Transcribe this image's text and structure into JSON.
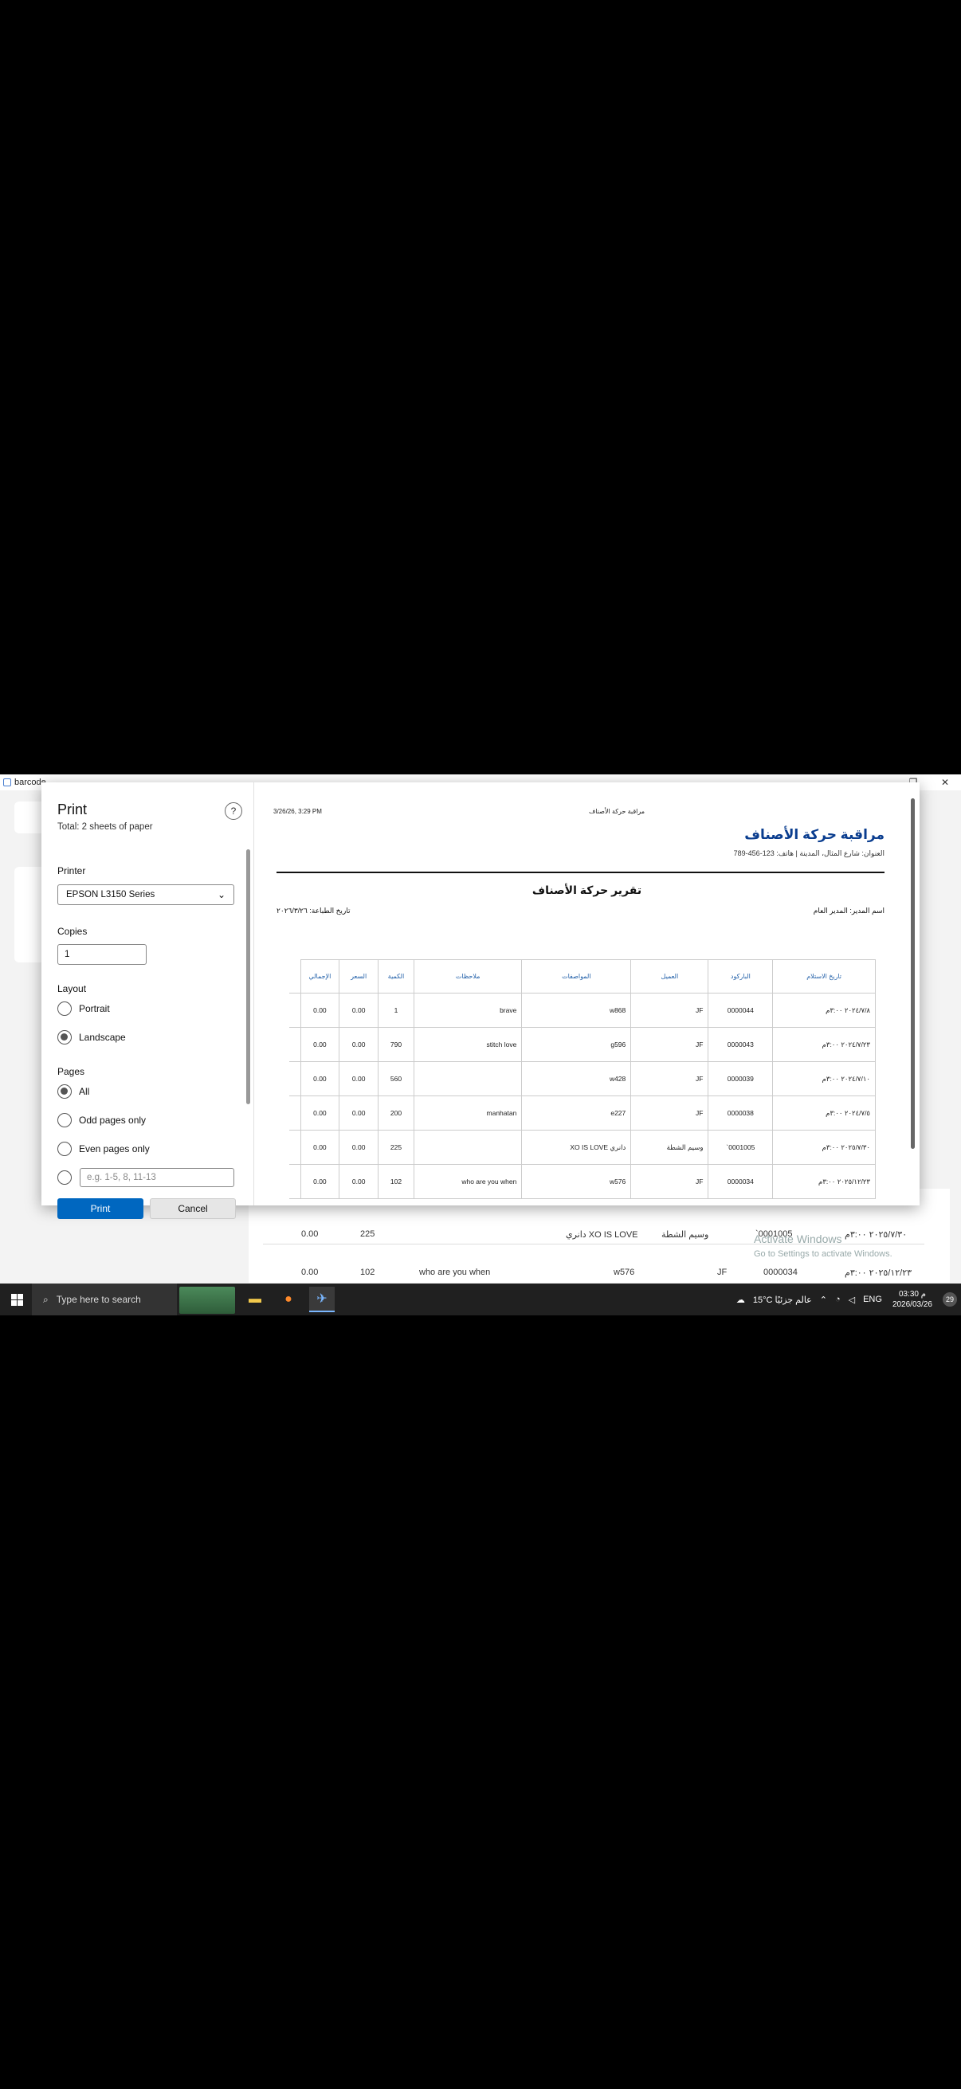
{
  "app": {
    "title": "barcode"
  },
  "window_controls": {
    "minimize": "—",
    "restore": "❐",
    "close": "✕"
  },
  "background": {
    "rows": [
      {
        "total": "0.00",
        "qty": "225",
        "notes": "",
        "desc": "XO IS LOVE دانري",
        "client": "وسيم الشطة",
        "barcode": "`0001005",
        "date": "٢٠٢٥/٧/٣٠ ٣:٠٠م"
      },
      {
        "total": "0.00",
        "qty": "102",
        "notes": "who are you when",
        "desc": "w576",
        "client": "JF",
        "barcode": "0000034",
        "date": "٢٠٢٥/١٢/٢٣ ٣:٠٠م"
      }
    ],
    "watermark_title": "Activate Windows",
    "watermark_sub": "Go to Settings to activate Windows."
  },
  "print": {
    "title": "Print",
    "subtitle": "Total: 2 sheets of paper",
    "help": "?",
    "printer_label": "Printer",
    "printer_value": "EPSON L3150 Series",
    "copies_label": "Copies",
    "copies_value": "1",
    "layout_label": "Layout",
    "portrait": "Portrait",
    "landscape": "Landscape",
    "pages_label": "Pages",
    "all": "All",
    "odd": "Odd pages only",
    "even": "Even pages only",
    "range_placeholder": "e.g. 1-5, 8, 11-13",
    "print_btn": "Print",
    "cancel_btn": "Cancel"
  },
  "preview": {
    "date": "3/26/26, 3:29 PM",
    "header_center": "مراقبة حركة الأصناف",
    "company_title": "مراقبة حركة الأصناف",
    "address": "العنوان: شارع المثال، المدينة | هاتف: 123-456-789",
    "report_title": "تقرير حركة الأصناف",
    "manager": "اسم المدير: المدير العام",
    "print_date": "تاريخ الطباعة: ٢٠٢٦/٣/٢٦",
    "headers": [
      "الإجمالي",
      "السعر",
      "الكمية",
      "ملاحظات",
      "المواصفات",
      "العميل",
      "الباركود",
      "تاريخ الاستلام"
    ],
    "rows": [
      [
        "0.00",
        "0.00",
        "1",
        "brave",
        "w868",
        "JF",
        "0000044",
        "٢٠٢٤/٧/٨ ٣:٠٠م"
      ],
      [
        "0.00",
        "0.00",
        "790",
        "stitch love",
        "g596",
        "JF",
        "0000043",
        "٢٠٢٤/٧/٢٣ ٣:٠٠م"
      ],
      [
        "0.00",
        "0.00",
        "560",
        "",
        "w428",
        "JF",
        "0000039",
        "٢٠٢٤/٧/١٠ ٣:٠٠م"
      ],
      [
        "0.00",
        "0.00",
        "200",
        "manhatan",
        "e227",
        "JF",
        "0000038",
        "٢٠٢٤/٧/٥ ٣:٠٠م"
      ],
      [
        "0.00",
        "0.00",
        "225",
        "",
        "XO IS LOVE دانري",
        "وسيم الشطة",
        "`0001005",
        "٢٠٢٥/٧/٣٠ ٣:٠٠م"
      ],
      [
        "0.00",
        "0.00",
        "102",
        "who are you when",
        "w576",
        "JF",
        "0000034",
        "٢٠٢٥/١٢/٢٣ ٣:٠٠م"
      ]
    ]
  },
  "taskbar": {
    "search_placeholder": "Type here to search",
    "weather": "15°C  عالم جزئيًا",
    "lang": "ENG",
    "time": "03:30 م",
    "date": "2026/03/26",
    "notif_count": "29"
  }
}
